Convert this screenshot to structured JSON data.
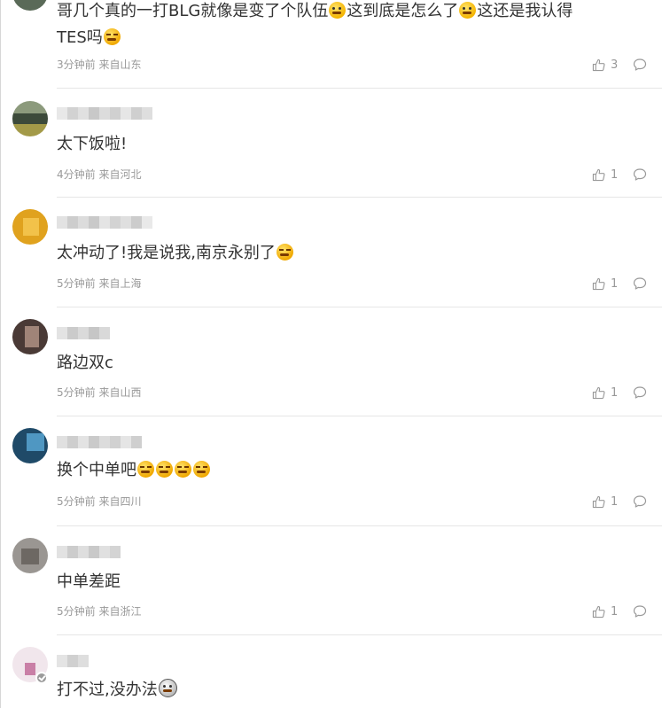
{
  "comments": [
    {
      "id": "c0",
      "text_parts": [
        {
          "line": [
            "哥几个真的一打BLG就像是变了个队伍",
            "{emoji:embarrassed}",
            "这到底是怎么了",
            "{emoji:embarrassed}",
            "这还是我认得"
          ]
        },
        {
          "line": [
            "TES吗",
            "{emoji:cry}"
          ]
        }
      ],
      "time": "3分钟前",
      "location": "来自山东",
      "likes": "3"
    },
    {
      "id": "c1",
      "text": "太下饭啦!",
      "time": "4分钟前",
      "location": "来自河北",
      "likes": "1"
    },
    {
      "id": "c2",
      "text": "太冲动了!我是说我,南京永别了",
      "emojis_after": [
        "laugh"
      ],
      "time": "5分钟前",
      "location": "来自上海",
      "likes": "1"
    },
    {
      "id": "c3",
      "text": "路边双c",
      "time": "5分钟前",
      "location": "来自山西",
      "likes": "1"
    },
    {
      "id": "c4",
      "text": "换个中单吧",
      "emojis_after": [
        "laugh",
        "laugh",
        "laugh",
        "laugh"
      ],
      "time": "5分钟前",
      "location": "来自四川",
      "likes": "1"
    },
    {
      "id": "c5",
      "text": "中单差距",
      "time": "5分钟前",
      "location": "来自浙江",
      "likes": "1"
    },
    {
      "id": "c6",
      "text": "打不过,没办法",
      "emojis_after": [
        "awkward"
      ],
      "verified": true
    }
  ],
  "icons": {
    "like": "thumbs-up-icon",
    "reply": "comment-bubble-icon",
    "verified": "verified-badge-icon"
  },
  "colors": {
    "text": "#333333",
    "meta": "#999999",
    "divider": "#e6e6e6"
  }
}
